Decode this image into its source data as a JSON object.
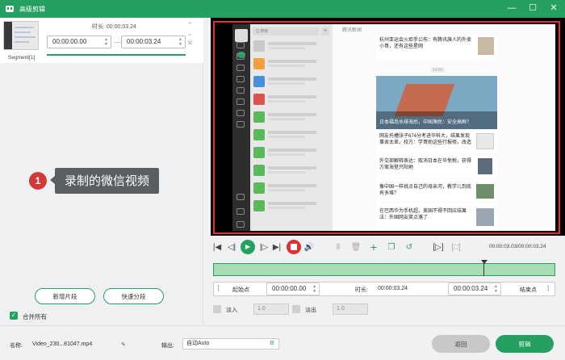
{
  "app": {
    "title": "高级剪辑"
  },
  "segment": {
    "label": "Segment[1]",
    "duration_label": "时长:",
    "duration_value": "00:00:03.24",
    "start_time": "00:00:00.00",
    "end_time": "00:00:03.24",
    "separator": "—"
  },
  "annotation": {
    "number": "1",
    "text": "录制的微信视频"
  },
  "left_buttons": {
    "new_segment": "新增片段",
    "quick_split": "快速分段"
  },
  "merge_all": {
    "label": "合并所有",
    "checked": true
  },
  "preview": {
    "wechat_search": "Q 搜索",
    "article_title": "腾讯新闻",
    "news": [
      {
        "text": "杭州亚运会火炬手公布：有腾讯旗人的外卖小哥，还有这些星网"
      },
      {
        "text": "日本福岛水排海后，中国渔民：安全高鲜？"
      },
      {
        "text": "网友托槽张子674分考进华科大，结果发现事舍太差，校方：学哥助这些行报修，改造"
      },
      {
        "text": "外交部解释表达：取消日本在华免税，获得方案海登只阳地"
      },
      {
        "text": "像中国一样挑点自己的母亲河，教学儿到底有多难？"
      },
      {
        "text": "在巴西华为手机超，美国不得不回应结果法：外国网友笑点落了"
      }
    ],
    "time_badge": "14:50"
  },
  "controls": {
    "timecode": "00:00:03.03/00:00:03.24"
  },
  "range": {
    "start_label": "起始点",
    "start_value": "00:00:00.00",
    "duration_label": "时长:",
    "duration_value": "00:00:03.24",
    "end_value": "00:00:03.24",
    "end_label": "结束点",
    "left_bracket": "[",
    "right_bracket": "]"
  },
  "fade": {
    "in_label": "淡入",
    "in_value": "1.0",
    "out_label": "淡出",
    "out_value": "1.0"
  },
  "bottom": {
    "name_label": "名称:",
    "file_name": "Video_230...81047.mp4",
    "output_label": "输出:",
    "output_value": "自动Auto",
    "back_button": "返回",
    "edit_button": "剪辑"
  },
  "colors": {
    "accent": "#25a060",
    "record": "#e03030"
  }
}
